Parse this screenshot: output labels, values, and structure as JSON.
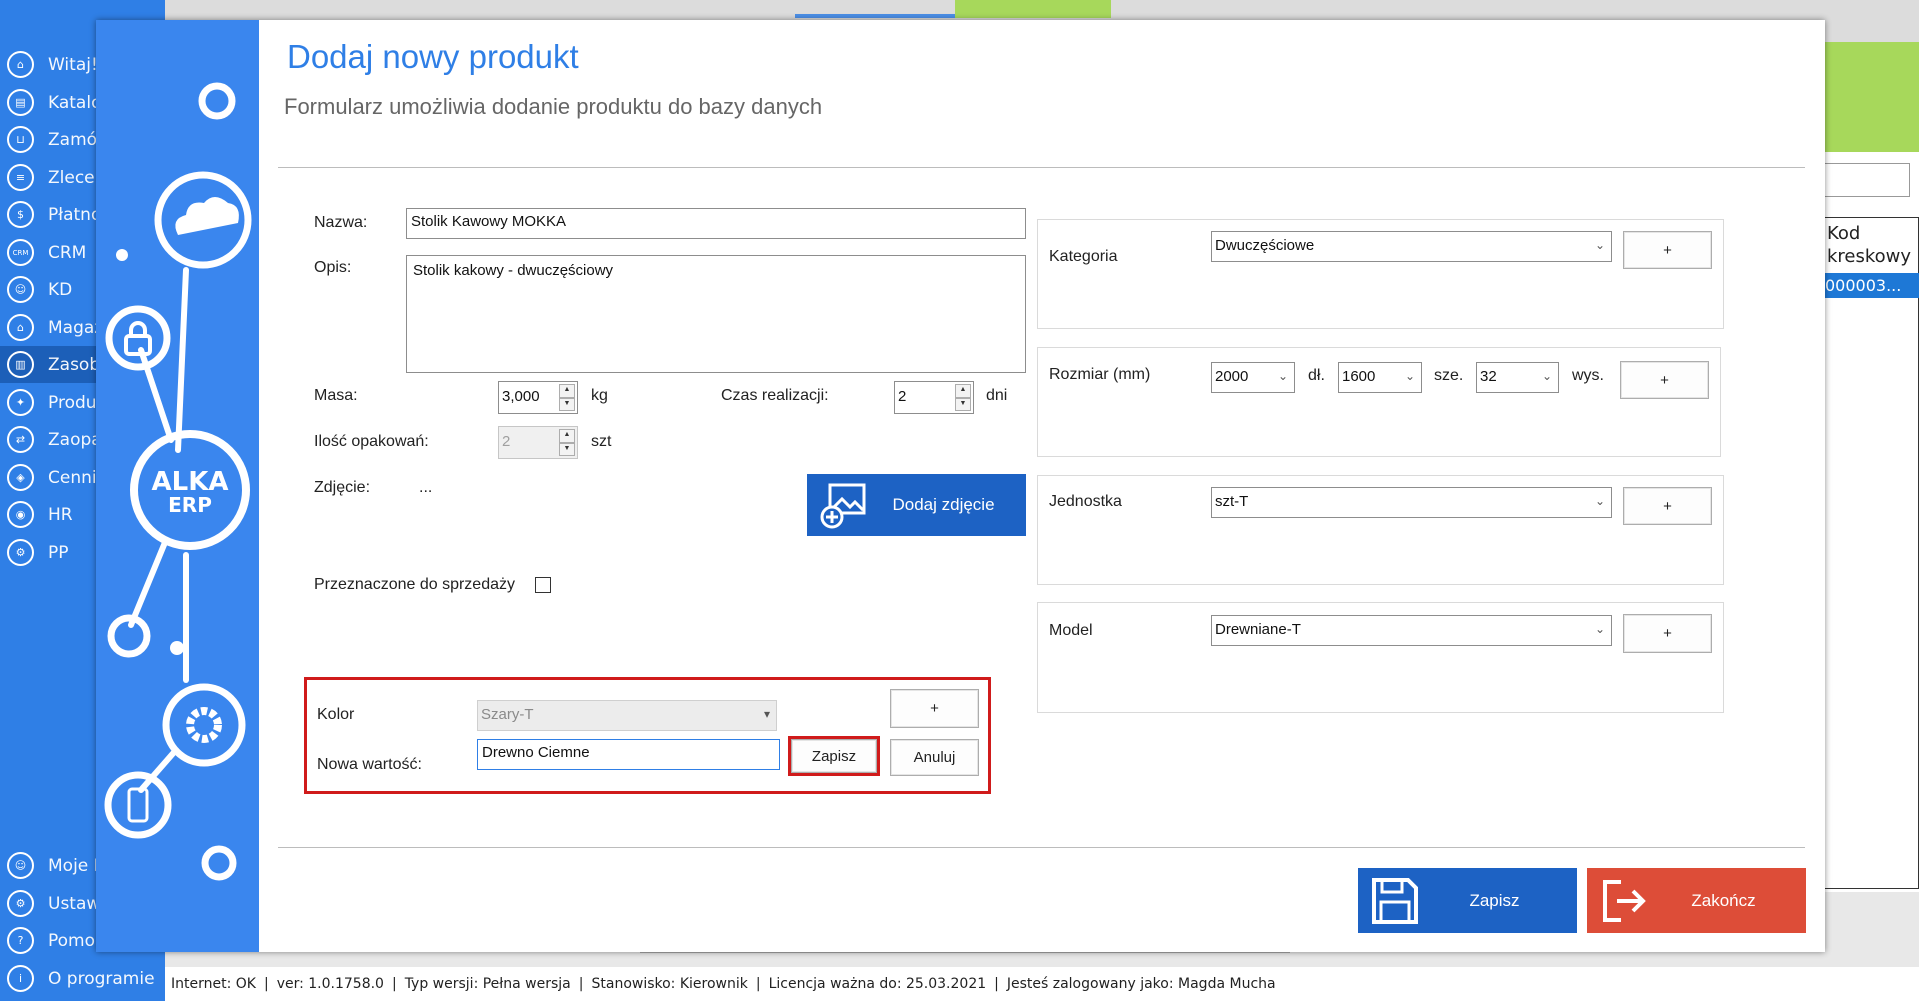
{
  "sidebar": {
    "items": [
      {
        "label": "Witaj!",
        "icon": "home-icon"
      },
      {
        "label": "Katalo",
        "icon": "book-icon"
      },
      {
        "label": "Zamó",
        "icon": "cart-icon"
      },
      {
        "label": "Zlecer",
        "icon": "list-icon"
      },
      {
        "label": "Płatno",
        "icon": "dollar-icon"
      },
      {
        "label": "CRM",
        "icon": "crm-icon",
        "icon_text": "CRM"
      },
      {
        "label": "KD",
        "icon": "person-icon"
      },
      {
        "label": "Magaz",
        "icon": "warehouse-icon"
      },
      {
        "label": "Zasob",
        "icon": "resources-icon"
      },
      {
        "label": "Produ",
        "icon": "production-icon"
      },
      {
        "label": "Zaopa",
        "icon": "supply-icon"
      },
      {
        "label": "Cennik",
        "icon": "tag-icon"
      },
      {
        "label": "HR",
        "icon": "hr-icon"
      },
      {
        "label": "PP",
        "icon": "pp-icon"
      }
    ],
    "bottom_items": [
      {
        "label": "Moje I",
        "icon": "user-icon"
      },
      {
        "label": "Ustawi",
        "icon": "gear-icon"
      },
      {
        "label": "Pomo",
        "icon": "help-icon"
      },
      {
        "label": "O programie",
        "icon": "info-icon"
      }
    ]
  },
  "background": {
    "right_header": "Kod\nkreskowy",
    "right_row": "000003..."
  },
  "dialog": {
    "title": "Dodaj nowy produkt",
    "subtitle": "Formularz umożliwia dodanie produktu do bazy danych",
    "logo_text": "ALKA\nERP",
    "form": {
      "name_label": "Nazwa:",
      "name_value": "Stolik Kawowy MOKKA",
      "desc_label": "Opis:",
      "desc_value": "Stolik kakowy - dwuczęściowy",
      "mass_label": "Masa:",
      "mass_value": "3,000",
      "mass_unit": "kg",
      "time_label": "Czas realizacji:",
      "time_value": "2",
      "time_unit": "dni",
      "packages_label": "Ilość opakowań:",
      "packages_value": "2",
      "packages_unit": "szt",
      "photo_label": "Zdjęcie:",
      "photo_value": "...",
      "add_photo_label": "Dodaj zdjęcie",
      "for_sale_label": "Przeznaczone do sprzedaży",
      "for_sale_checked": false
    },
    "color": {
      "label": "Kolor",
      "value": "Szary-T",
      "add_label": "+",
      "new_value_label": "Nowa wartość:",
      "new_value": "Drewno Ciemne",
      "save_label": "Zapisz",
      "cancel_label": "Anuluj"
    },
    "category": {
      "label": "Kategoria",
      "value": "Dwuczęściowe",
      "add_label": "+"
    },
    "size": {
      "label": "Rozmiar (mm)",
      "length_value": "2000",
      "length_unit": "dł.",
      "width_value": "1600",
      "width_unit": "sze.",
      "height_value": "32",
      "height_unit": "wys.",
      "add_label": "+"
    },
    "unit": {
      "label": "Jednostka",
      "value": "szt-T",
      "add_label": "+"
    },
    "model": {
      "label": "Model",
      "value": "Drewniane-T",
      "add_label": "+"
    },
    "save_label": "Zapisz",
    "finish_label": "Zakończ"
  },
  "status_bar": {
    "internet": "Internet: OK",
    "version": "ver: 1.0.1758.0",
    "version_type": "Typ wersji: Pełna wersja",
    "station": "Stanowisko: Kierownik",
    "license": "Licencja ważna do: 25.03.2021",
    "user": "Jesteś zalogowany jako: Magda Mucha",
    "separator": "|"
  },
  "colors": {
    "primary_blue": "#2f7fe6",
    "button_blue": "#1d62c4",
    "finish_red": "#dd4d38",
    "highlight_red": "#d01b1b",
    "accent_green": "#a7d85b"
  }
}
